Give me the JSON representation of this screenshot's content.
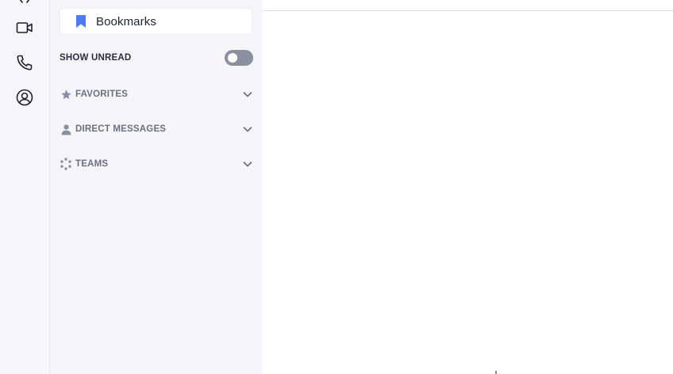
{
  "rail": {
    "items": [
      {
        "icon": "video-icon"
      },
      {
        "icon": "phone-icon"
      },
      {
        "icon": "user-circle-icon"
      }
    ]
  },
  "sidebar": {
    "bookmarks": {
      "label": "Bookmarks",
      "icon": "bookmark-icon",
      "icon_color": "#4f7cf0"
    },
    "show_unread": {
      "label": "SHOW UNREAD",
      "enabled": false
    },
    "sections": [
      {
        "label": "FAVORITES",
        "icon": "star-icon"
      },
      {
        "label": "DIRECT MESSAGES",
        "icon": "person-icon"
      },
      {
        "label": "TEAMS",
        "icon": "teams-dots-icon"
      }
    ]
  },
  "colors": {
    "accent": "#4f7cf0",
    "sidebar_bg": "#f4f4f9",
    "toggle_off": "#8a90a0"
  }
}
